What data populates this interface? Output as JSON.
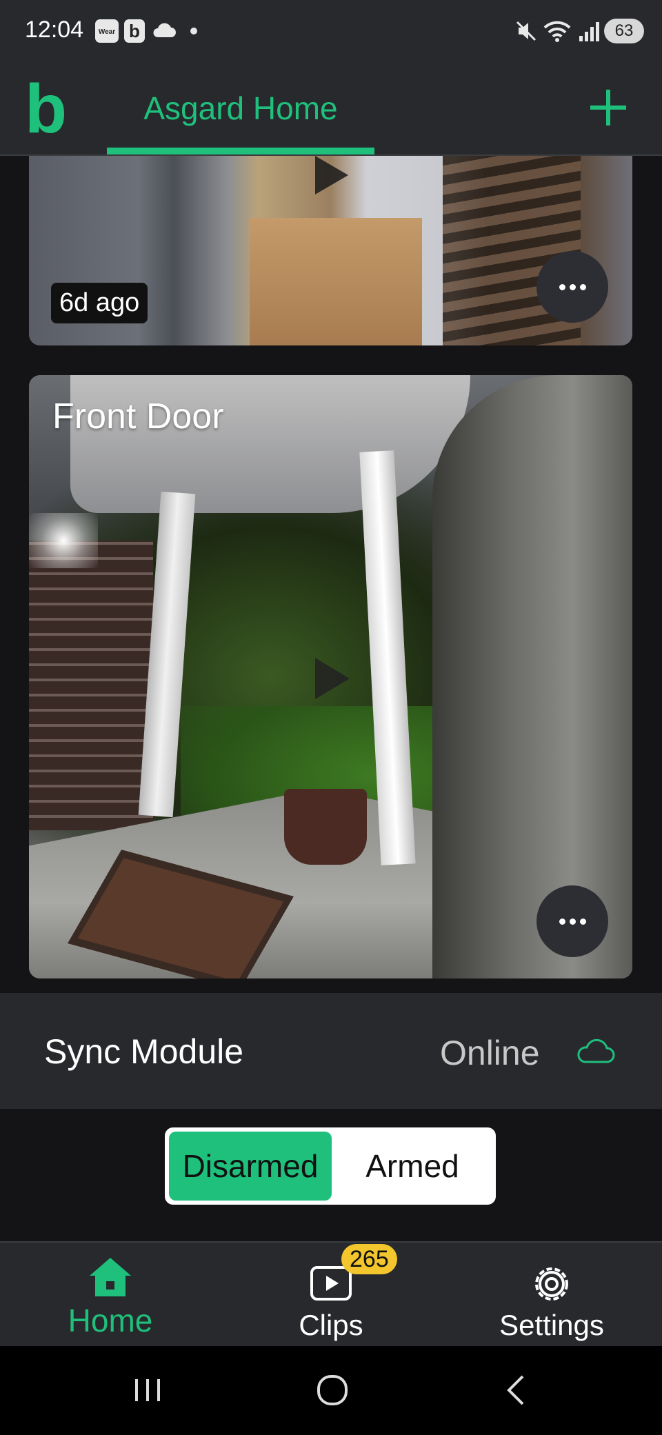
{
  "status_bar": {
    "time": "12:04",
    "icons": [
      "wear-icon",
      "b-app-icon",
      "cloud-icon",
      "dot-icon",
      "mute-icon",
      "wifi-icon",
      "signal-icon"
    ],
    "wear_label": "Wear",
    "b_label": "b",
    "battery": "63"
  },
  "header": {
    "logo": "b",
    "home_tab": "Asgard Home",
    "accent_color": "#1fc07c"
  },
  "cameras": [
    {
      "name": "",
      "last_seen": "6d ago"
    },
    {
      "name": "Front Door",
      "last_seen": ""
    }
  ],
  "sync_module": {
    "title": "Sync Module",
    "status": "Online"
  },
  "arm_toggle": {
    "disarmed_label": "Disarmed",
    "armed_label": "Armed",
    "selected": "Disarmed"
  },
  "bottom_nav": {
    "home_label": "Home",
    "clips_label": "Clips",
    "clips_count": "265",
    "settings_label": "Settings",
    "active": "Home"
  }
}
